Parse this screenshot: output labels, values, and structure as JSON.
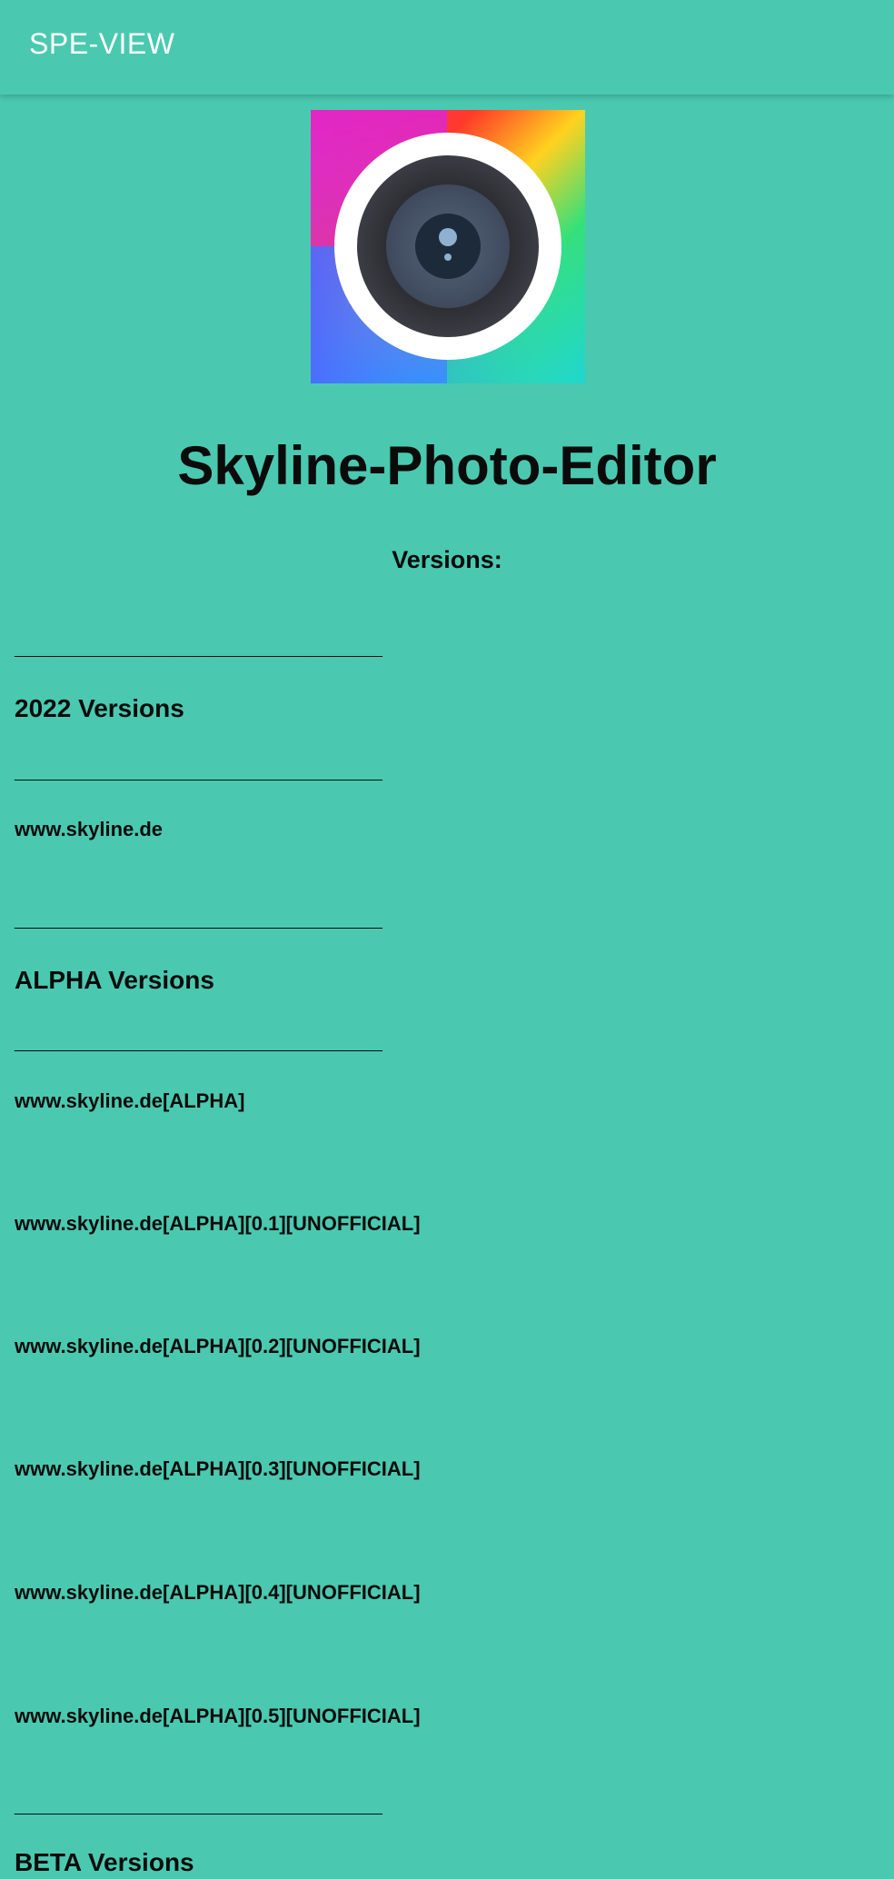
{
  "appbar": {
    "title": "SPE-VIEW"
  },
  "header": {
    "app_name": "Skyline-Photo-Editor",
    "versions_label": "Versions:"
  },
  "divider_text": "______________________________",
  "sections": {
    "versions_2022": {
      "heading": "2022 Versions",
      "links": [
        "www.skyline.de"
      ]
    },
    "alpha": {
      "heading": "ALPHA Versions",
      "links": [
        "www.skyline.de[ALPHA]",
        "www.skyline.de[ALPHA][0.1][UNOFFICIAL]",
        "www.skyline.de[ALPHA][0.2][UNOFFICIAL]",
        "www.skyline.de[ALPHA][0.3][UNOFFICIAL]",
        "www.skyline.de[ALPHA][0.4][UNOFFICIAL]",
        "www.skyline.de[ALPHA][0.5][UNOFFICIAL]"
      ]
    },
    "beta": {
      "heading": "BETA Versions"
    }
  }
}
